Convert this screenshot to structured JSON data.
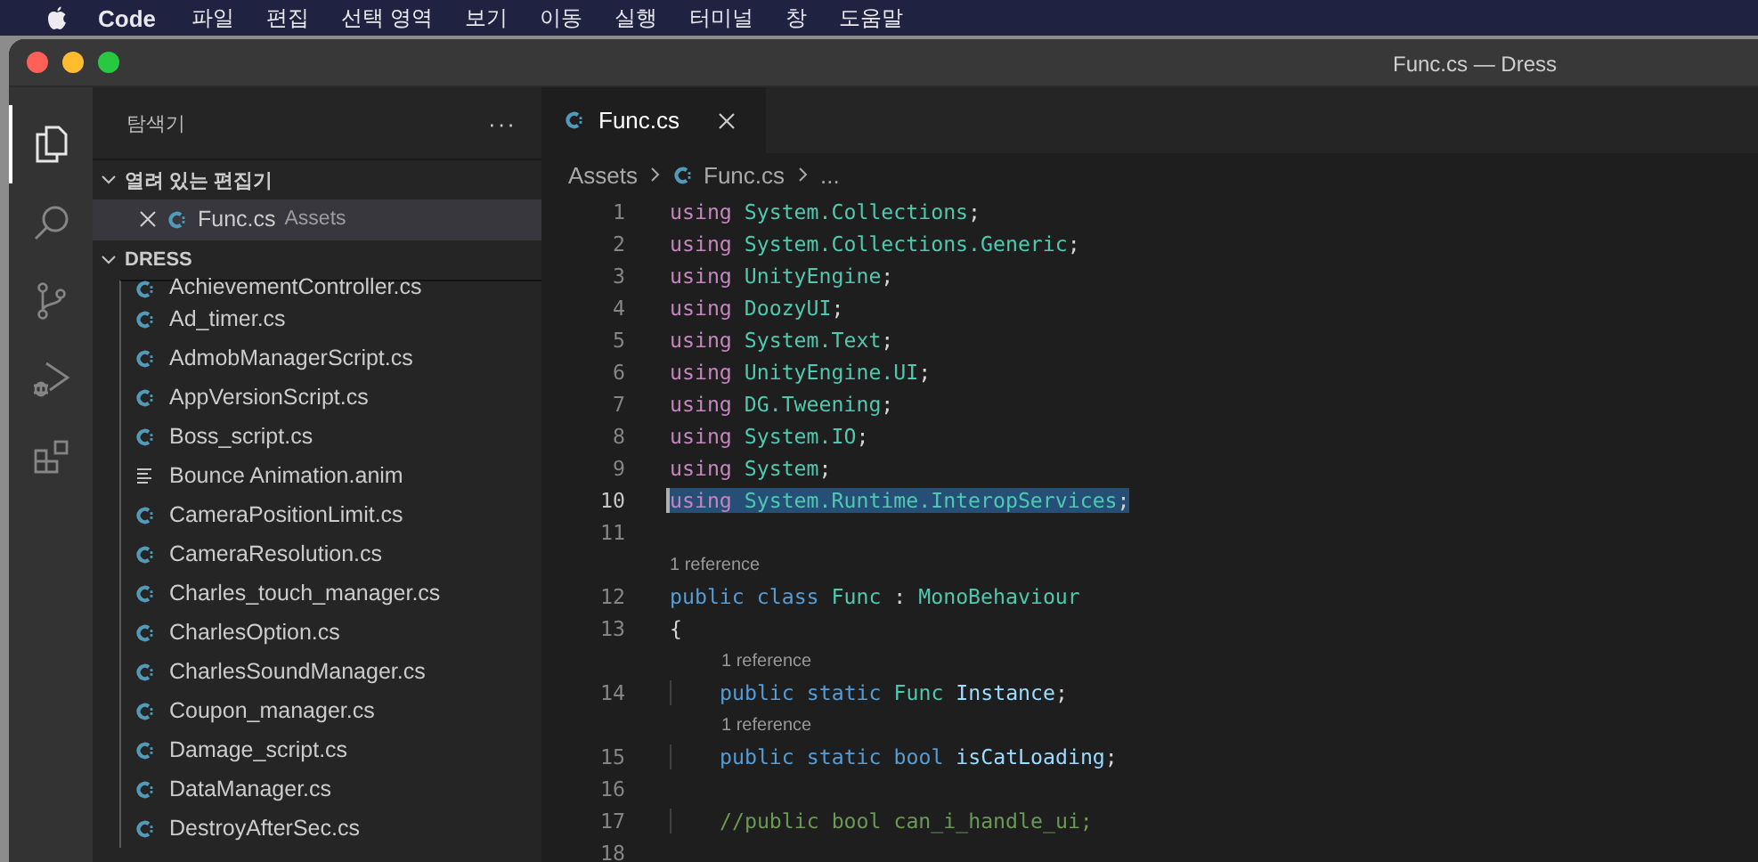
{
  "menu_bar": {
    "app": "Code",
    "items": [
      "파일",
      "편집",
      "선택 영역",
      "보기",
      "이동",
      "실행",
      "터미널",
      "창",
      "도움말"
    ]
  },
  "window": {
    "title": "Func.cs — Dress"
  },
  "activity_bar": [
    {
      "kind": "explorer",
      "selected": true
    },
    {
      "kind": "search",
      "selected": false
    },
    {
      "kind": "source-control",
      "selected": false
    },
    {
      "kind": "run-debug",
      "selected": false
    },
    {
      "kind": "extensions",
      "selected": false
    }
  ],
  "sidebar": {
    "title": "탐색기",
    "more": "···",
    "open_editors": {
      "title": "열려 있는 편집기",
      "expanded": true,
      "items": [
        {
          "name": "Func.cs",
          "folder": "Assets",
          "kind": "csharp",
          "selected": true
        }
      ]
    },
    "folder": {
      "title": "DRESS",
      "expanded": true,
      "files": [
        {
          "name": "AchievementController.cs",
          "kind": "csharp"
        },
        {
          "name": "Ad_timer.cs",
          "kind": "csharp"
        },
        {
          "name": "AdmobManagerScript.cs",
          "kind": "csharp"
        },
        {
          "name": "AppVersionScript.cs",
          "kind": "csharp"
        },
        {
          "name": "Boss_script.cs",
          "kind": "csharp"
        },
        {
          "name": "Bounce Animation.anim",
          "kind": "text"
        },
        {
          "name": "CameraPositionLimit.cs",
          "kind": "csharp"
        },
        {
          "name": "CameraResolution.cs",
          "kind": "csharp"
        },
        {
          "name": "Charles_touch_manager.cs",
          "kind": "csharp"
        },
        {
          "name": "CharlesOption.cs",
          "kind": "csharp"
        },
        {
          "name": "CharlesSoundManager.cs",
          "kind": "csharp"
        },
        {
          "name": "Coupon_manager.cs",
          "kind": "csharp"
        },
        {
          "name": "Damage_script.cs",
          "kind": "csharp"
        },
        {
          "name": "DataManager.cs",
          "kind": "csharp"
        },
        {
          "name": "DestroyAfterSec.cs",
          "kind": "csharp"
        }
      ]
    }
  },
  "tabs": [
    {
      "label": "Func.cs",
      "kind": "csharp",
      "selected": true
    }
  ],
  "breadcrumb": [
    {
      "label": "Assets",
      "kind": "folder"
    },
    {
      "label": "Func.cs",
      "kind": "csharp"
    },
    {
      "label": "...",
      "kind": "symbol"
    }
  ],
  "code": {
    "lines": [
      {
        "number": "1",
        "selected": false,
        "indented": false,
        "tokens": [
          {
            "kind": "keyword",
            "text": "using"
          },
          {
            "kind": "type",
            "text": "System.Collections"
          },
          {
            "kind": "punct",
            "text": ";"
          }
        ]
      },
      {
        "number": "2",
        "selected": false,
        "indented": false,
        "tokens": [
          {
            "kind": "keyword",
            "text": "using"
          },
          {
            "kind": "type",
            "text": "System.Collections.Generic"
          },
          {
            "kind": "punct",
            "text": ";"
          }
        ]
      },
      {
        "number": "3",
        "selected": false,
        "indented": false,
        "tokens": [
          {
            "kind": "keyword",
            "text": "using"
          },
          {
            "kind": "type",
            "text": "UnityEngine"
          },
          {
            "kind": "punct",
            "text": ";"
          }
        ]
      },
      {
        "number": "4",
        "selected": false,
        "indented": false,
        "tokens": [
          {
            "kind": "keyword",
            "text": "using"
          },
          {
            "kind": "type",
            "text": "DoozyUI"
          },
          {
            "kind": "punct",
            "text": ";"
          }
        ]
      },
      {
        "number": "5",
        "selected": false,
        "indented": false,
        "tokens": [
          {
            "kind": "keyword",
            "text": "using"
          },
          {
            "kind": "type",
            "text": "System.Text"
          },
          {
            "kind": "punct",
            "text": ";"
          }
        ]
      },
      {
        "number": "6",
        "selected": false,
        "indented": false,
        "tokens": [
          {
            "kind": "keyword",
            "text": "using"
          },
          {
            "kind": "type",
            "text": "UnityEngine.UI"
          },
          {
            "kind": "punct",
            "text": ";"
          }
        ]
      },
      {
        "number": "7",
        "selected": false,
        "indented": false,
        "tokens": [
          {
            "kind": "keyword",
            "text": "using"
          },
          {
            "kind": "type",
            "text": "DG.Tweening"
          },
          {
            "kind": "punct",
            "text": ";"
          }
        ]
      },
      {
        "number": "8",
        "selected": false,
        "indented": false,
        "tokens": [
          {
            "kind": "keyword",
            "text": "using"
          },
          {
            "kind": "type",
            "text": "System.IO"
          },
          {
            "kind": "punct",
            "text": ";"
          }
        ]
      },
      {
        "number": "9",
        "selected": false,
        "indented": false,
        "tokens": [
          {
            "kind": "keyword",
            "text": "using"
          },
          {
            "kind": "type",
            "text": "System"
          },
          {
            "kind": "punct",
            "text": ";"
          }
        ]
      },
      {
        "number": "10",
        "selected": true,
        "indented": false,
        "tokens": [
          {
            "kind": "keyword",
            "text": "using"
          },
          {
            "kind": "type",
            "text": "System.Runtime.InteropServices"
          },
          {
            "kind": "punct",
            "text": ";"
          }
        ]
      },
      {
        "number": "11",
        "selected": false
      },
      {
        "number": "12",
        "selected": false,
        "indented": false,
        "codelens": "1 reference",
        "tokens": [
          {
            "kind": "storage",
            "text": "public"
          },
          {
            "kind": "storage",
            "text": "class"
          },
          {
            "kind": "type",
            "text": "Func"
          },
          {
            "kind": "operator",
            "text": ":"
          },
          {
            "kind": "type",
            "text": "MonoBehaviour"
          }
        ]
      },
      {
        "number": "13",
        "selected": false,
        "indented": false,
        "tokens": [
          {
            "kind": "operator",
            "text": "{"
          }
        ]
      },
      {
        "number": "14",
        "selected": false,
        "indented": true,
        "codelens": "1 reference",
        "tokens": [
          {
            "kind": "storage",
            "text": "public"
          },
          {
            "kind": "storage",
            "text": "static"
          },
          {
            "kind": "type",
            "text": "Func"
          },
          {
            "kind": "variable",
            "text": "Instance"
          },
          {
            "kind": "punct",
            "text": ";"
          }
        ]
      },
      {
        "number": "15",
        "selected": false,
        "indented": true,
        "codelens": "1 reference",
        "tokens": [
          {
            "kind": "storage",
            "text": "public"
          },
          {
            "kind": "storage",
            "text": "static"
          },
          {
            "kind": "storage",
            "text": "bool"
          },
          {
            "kind": "variable",
            "text": "isCatLoading"
          },
          {
            "kind": "punct",
            "text": ";"
          }
        ]
      },
      {
        "number": "16",
        "selected": false
      },
      {
        "number": "17",
        "selected": false,
        "indented": true,
        "tokens": [
          {
            "kind": "comment",
            "text": "//public bool can_i_handle_ui;"
          }
        ]
      },
      {
        "number": "18",
        "selected": false
      }
    ]
  }
}
